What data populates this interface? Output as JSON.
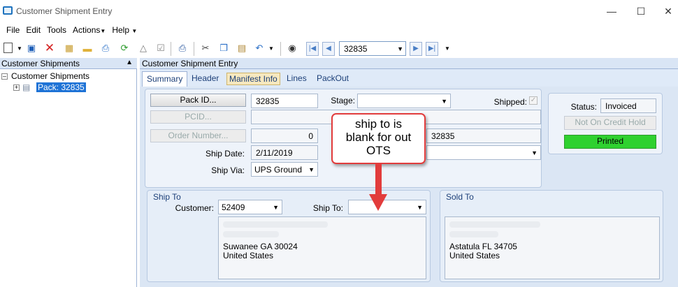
{
  "window": {
    "title": "Customer Shipment Entry"
  },
  "menu": [
    "File",
    "Edit",
    "Tools",
    "Actions",
    "Help"
  ],
  "toolbar": {
    "pack_combo_value": "32835"
  },
  "left_panel": {
    "header": "Customer Shipments",
    "tree_root": "Customer Shipments",
    "tree_child": "Pack: 32835"
  },
  "right_panel": {
    "header": "Customer Shipment Entry"
  },
  "tabs": [
    "Summary",
    "Header",
    "Manifest Info",
    "Lines",
    "PackOut"
  ],
  "summary": {
    "pack_id_button": "Pack ID...",
    "pack_id_value": "32835",
    "stage_label": "Stage:",
    "stage_value": "",
    "shipped_label": "Shipped:",
    "pcid_button": "PCID...",
    "order_number_button": "Order Number...",
    "order_number_value": "0",
    "order_right_value": "32835",
    "ship_date_label": "Ship Date:",
    "ship_date_value": "2/11/2019",
    "ship_via_label": "Ship Via:",
    "ship_via_value": "UPS Ground"
  },
  "status": {
    "status_label": "Status:",
    "status_value": "Invoiced",
    "credit_hold_button": "Not On Credit Hold",
    "printed_button": "Printed",
    "printed_color": "#2fd12f"
  },
  "ship_to": {
    "group_title": "Ship To",
    "customer_label": "Customer:",
    "customer_value": "52409",
    "ship_to_label": "Ship To:",
    "ship_to_value": "",
    "address_line_city": "Suwanee GA 30024",
    "address_line_country": "United States"
  },
  "sold_to": {
    "group_title": "Sold To",
    "address_line_city": "Astatula FL 34705",
    "address_line_country": "United States"
  },
  "annotation": {
    "lines": [
      "ship to is",
      "blank for out",
      "OTS"
    ],
    "color": "#e23c3c"
  }
}
